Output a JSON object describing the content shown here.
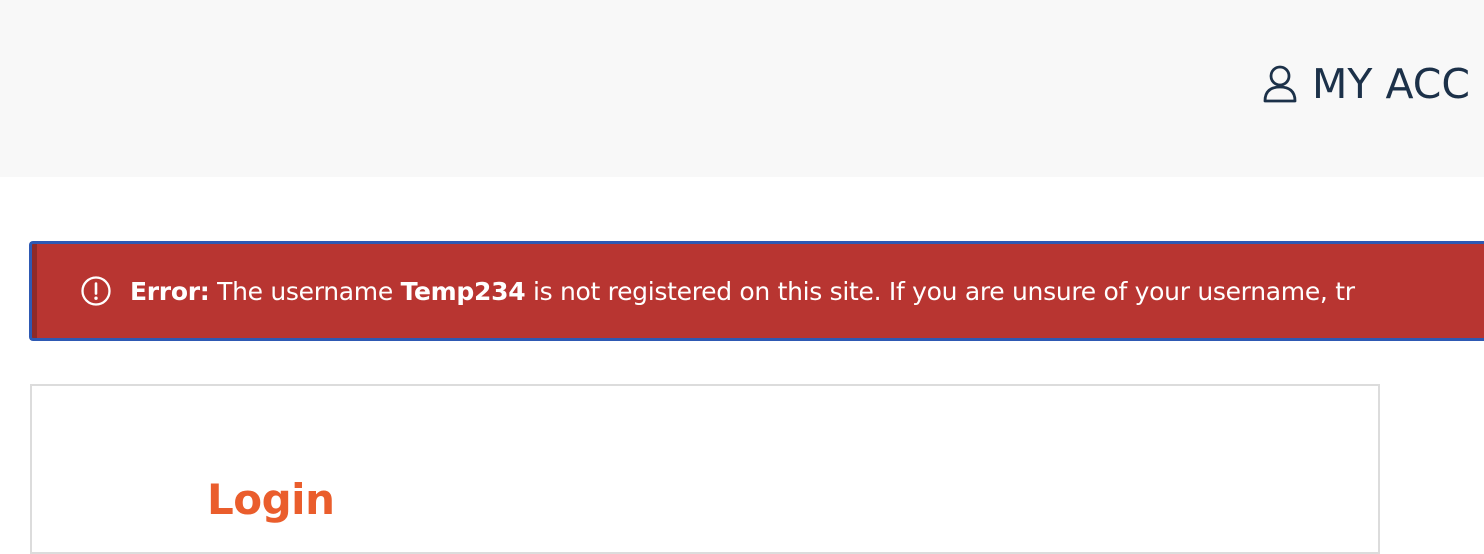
{
  "header": {
    "account_label": "MY ACC",
    "account_icon": "user-icon"
  },
  "error": {
    "icon": "alert-circle-icon",
    "label": "Error:",
    "message_before": " The username ",
    "username": "Temp234",
    "message_after": " is not registered on this site. If you are unsure of your username, tr"
  },
  "login": {
    "title": "Login"
  },
  "colors": {
    "header_bg": "#f8f8f8",
    "account_text": "#1c3149",
    "error_bg": "#b83531",
    "error_border": "#2e59b3",
    "login_title": "#ea5d2c",
    "panel_border": "#dcdcdc"
  }
}
